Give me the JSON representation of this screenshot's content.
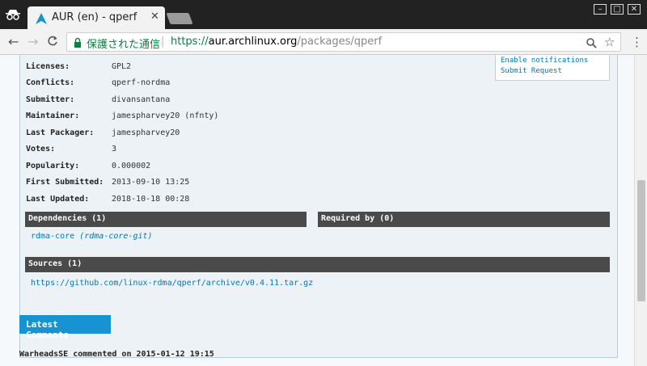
{
  "tab": {
    "title": "AUR (en) - qperf",
    "close": "✕"
  },
  "window": {
    "minimize": "–",
    "maximize": "□",
    "close": "✕"
  },
  "toolbar": {
    "secure_label": "保護された通信",
    "separator": "|",
    "url_proto": "https://",
    "url_host": "aur.archlinux.org",
    "url_path": "/packages/qperf",
    "back": "←",
    "forward": "→",
    "reload": "C",
    "zoom_icon": "🔍",
    "star_icon": "☆",
    "menu_icon": "⋮"
  },
  "actions": [
    "Enable notifications",
    "Submit Request"
  ],
  "details": [
    {
      "k": "Licenses:",
      "v": "GPL2"
    },
    {
      "k": "Conflicts:",
      "v": "qperf-nordma"
    },
    {
      "k": "Submitter:",
      "v": "divansantana"
    },
    {
      "k": "Maintainer:",
      "v": "jamespharvey20 (nfnty)"
    },
    {
      "k": "Last Packager:",
      "v": "jamespharvey20"
    },
    {
      "k": "Votes:",
      "v": "3"
    },
    {
      "k": "Popularity:",
      "v": "0.000002"
    },
    {
      "k": "First Submitted:",
      "v": "2013-09-10 13:25"
    },
    {
      "k": "Last Updated:",
      "v": "2018-10-18 00:28"
    }
  ],
  "dependencies": {
    "header": "Dependencies (1)",
    "name": "rdma-core",
    "alt": "(rdma-core-git)"
  },
  "required_by": {
    "header": "Required by (0)"
  },
  "sources": {
    "header": "Sources (1)",
    "link": "https://github.com/linux-rdma/qperf/archive/v0.4.11.tar.gz"
  },
  "comments": {
    "header": "Latest Comments",
    "first": "WarheadsSE commented on 2015-01-12 19:15"
  }
}
